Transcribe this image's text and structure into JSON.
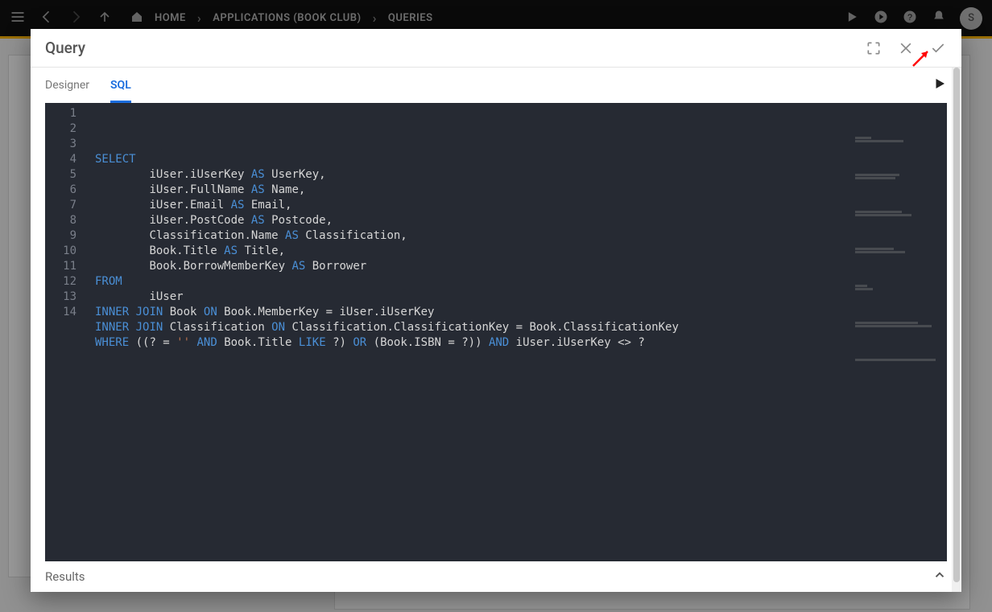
{
  "topbar": {
    "breadcrumbs": [
      "HOME",
      "APPLICATIONS (BOOK CLUB)",
      "QUERIES"
    ],
    "avatar_letter": "S"
  },
  "modal": {
    "title": "Query",
    "tabs": {
      "designer": "Designer",
      "sql": "SQL"
    },
    "results_label": "Results"
  },
  "code": {
    "lines": [
      {
        "n": "1",
        "indent": 0,
        "tokens": [
          {
            "t": "SELECT",
            "c": "kw"
          }
        ]
      },
      {
        "n": "2",
        "indent": 2,
        "tokens": [
          {
            "t": "iUser.iUserKey ",
            "c": "c-default"
          },
          {
            "t": "AS",
            "c": "kw"
          },
          {
            "t": " UserKey,",
            "c": "c-default"
          }
        ]
      },
      {
        "n": "3",
        "indent": 2,
        "tokens": [
          {
            "t": "iUser.FullName ",
            "c": "c-default"
          },
          {
            "t": "AS",
            "c": "kw"
          },
          {
            "t": " Name,",
            "c": "c-default"
          }
        ]
      },
      {
        "n": "4",
        "indent": 2,
        "tokens": [
          {
            "t": "iUser.Email ",
            "c": "c-default"
          },
          {
            "t": "AS",
            "c": "kw"
          },
          {
            "t": " Email,",
            "c": "c-default"
          }
        ]
      },
      {
        "n": "5",
        "indent": 2,
        "tokens": [
          {
            "t": "iUser.PostCode ",
            "c": "c-default"
          },
          {
            "t": "AS",
            "c": "kw"
          },
          {
            "t": " Postcode,",
            "c": "c-default"
          }
        ]
      },
      {
        "n": "6",
        "indent": 2,
        "tokens": [
          {
            "t": "Classification.Name ",
            "c": "c-default"
          },
          {
            "t": "AS",
            "c": "kw"
          },
          {
            "t": " Classification,",
            "c": "c-default"
          }
        ]
      },
      {
        "n": "7",
        "indent": 2,
        "tokens": [
          {
            "t": "Book.Title ",
            "c": "c-default"
          },
          {
            "t": "AS",
            "c": "kw"
          },
          {
            "t": " Title,",
            "c": "c-default"
          }
        ]
      },
      {
        "n": "8",
        "indent": 2,
        "tokens": [
          {
            "t": "Book.BorrowMemberKey ",
            "c": "c-default"
          },
          {
            "t": "AS",
            "c": "kw"
          },
          {
            "t": " Borrower",
            "c": "c-default"
          }
        ]
      },
      {
        "n": "9",
        "indent": 0,
        "tokens": [
          {
            "t": "FROM",
            "c": "kw"
          }
        ]
      },
      {
        "n": "10",
        "indent": 2,
        "tokens": [
          {
            "t": "iUser",
            "c": "c-default"
          }
        ]
      },
      {
        "n": "11",
        "indent": 0,
        "tokens": [
          {
            "t": "INNER",
            "c": "kw"
          },
          {
            "t": " ",
            "c": "c-default"
          },
          {
            "t": "JOIN",
            "c": "kw"
          },
          {
            "t": " Book ",
            "c": "c-default"
          },
          {
            "t": "ON",
            "c": "kw"
          },
          {
            "t": " Book.MemberKey = iUser.iUserKey",
            "c": "c-default"
          }
        ]
      },
      {
        "n": "12",
        "indent": 0,
        "tokens": [
          {
            "t": "INNER",
            "c": "kw"
          },
          {
            "t": " ",
            "c": "c-default"
          },
          {
            "t": "JOIN",
            "c": "kw"
          },
          {
            "t": " Classification ",
            "c": "c-default"
          },
          {
            "t": "ON",
            "c": "kw"
          },
          {
            "t": " Classification.ClassificationKey = Book.ClassificationKey",
            "c": "c-default"
          }
        ]
      },
      {
        "n": "13",
        "indent": 0,
        "tokens": [
          {
            "t": "WHERE",
            "c": "kw"
          },
          {
            "t": " ((? = ",
            "c": "c-default"
          },
          {
            "t": "''",
            "c": "str"
          },
          {
            "t": " ",
            "c": "c-default"
          },
          {
            "t": "AND",
            "c": "kw"
          },
          {
            "t": " Book.Title ",
            "c": "c-default"
          },
          {
            "t": "LIKE",
            "c": "kw"
          },
          {
            "t": " ?) ",
            "c": "c-default"
          },
          {
            "t": "OR",
            "c": "kw"
          },
          {
            "t": " (Book.ISBN = ?)) ",
            "c": "c-default"
          },
          {
            "t": "AND",
            "c": "kw"
          },
          {
            "t": " iUser.iUserKey <> ?",
            "c": "c-default"
          }
        ]
      },
      {
        "n": "14",
        "indent": 0,
        "tokens": []
      }
    ]
  }
}
